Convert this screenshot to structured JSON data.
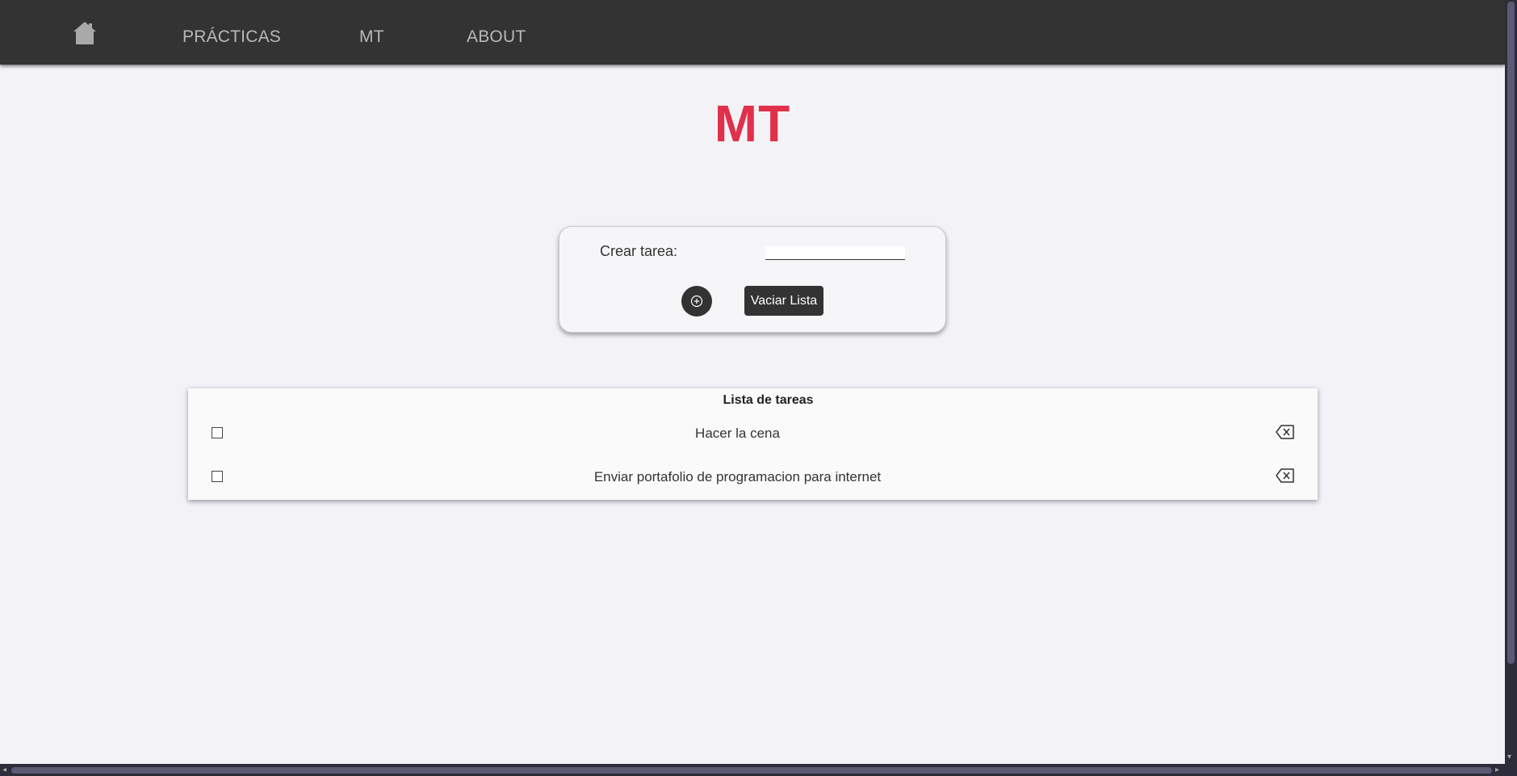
{
  "nav": {
    "home_icon": "home-icon",
    "links": [
      "PRÁCTICAS",
      "MT",
      "ABOUT"
    ]
  },
  "page": {
    "title": "MT",
    "title_color": "#e0304a"
  },
  "form": {
    "label": "Crear tarea:",
    "input_value": "",
    "add_icon": "plus-circle-icon",
    "clear_label": "Vaciar Lista"
  },
  "list": {
    "title": "Lista de tareas",
    "items": [
      {
        "text": "Hacer la cena",
        "checked": false
      },
      {
        "text": "Enviar portafolio de programacion para internet",
        "checked": false
      }
    ],
    "delete_icon": "backspace-delete-icon"
  }
}
